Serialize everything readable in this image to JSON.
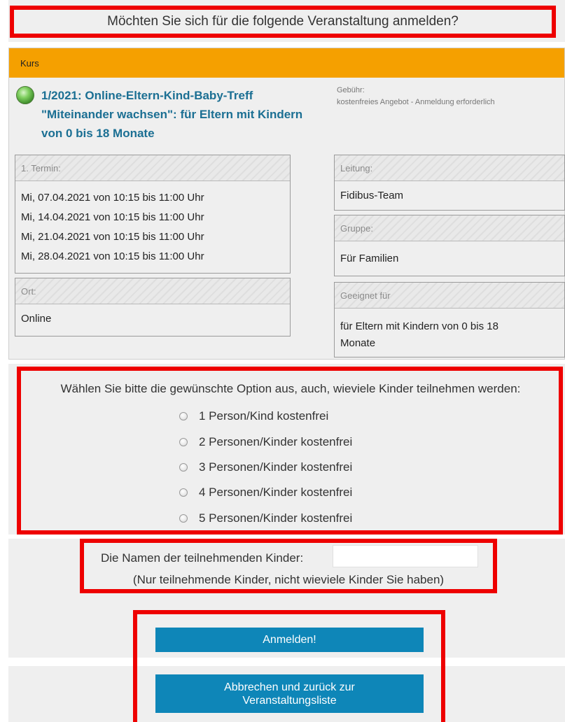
{
  "question": "Möchten Sie sich für die folgende Veranstaltung anmelden?",
  "course": {
    "header": "Kurs",
    "title_lines": [
      "1/2021: Online-Eltern-Kind-Baby-Treff",
      "\"Miteinander wachsen\": für Eltern mit Kindern",
      "von 0 bis 18 Monate"
    ],
    "fee_label": "Gebühr:",
    "fee_value": "kostenfreies Angebot - Anmeldung erforderlich",
    "termin": {
      "label": "1. Termin:",
      "dates": [
        "Mi, 07.04.2021 von 10:15 bis 11:00 Uhr",
        "Mi, 14.04.2021 von 10:15 bis 11:00 Uhr",
        "Mi, 21.04.2021 von 10:15 bis 11:00 Uhr",
        "Mi, 28.04.2021 von 10:15 bis 11:00 Uhr"
      ]
    },
    "ort": {
      "label": "Ort:",
      "value": "Online"
    },
    "leitung": {
      "label": "Leitung:",
      "value": "Fidibus-Team"
    },
    "gruppe": {
      "label": "Gruppe:",
      "value": "Für Familien"
    },
    "geeignet": {
      "label": "Geeignet für",
      "lines": [
        "für Eltern mit Kindern von 0 bis 18",
        "Monate"
      ]
    }
  },
  "options": {
    "prompt": "Wählen Sie bitte die gewünschte Option aus, auch, wieviele Kinder teilnehmen werden:",
    "items": [
      "1 Person/Kind kostenfrei",
      "2 Personen/Kinder kostenfrei",
      "3 Personen/Kinder kostenfrei",
      "4 Personen/Kinder kostenfrei",
      "5 Personen/Kinder kostenfrei"
    ]
  },
  "children": {
    "label": "Die Namen der teilnehmenden Kinder:",
    "value": "",
    "note": "(Nur teilnehmende Kinder, nicht wieviele Kinder Sie haben)"
  },
  "buttons": {
    "register": "Anmelden!",
    "cancel_lines": [
      "Abbrechen und zurück zur",
      "Veranstaltungsliste"
    ]
  },
  "colors": {
    "accent_header": "#f5a000",
    "title_blue": "#1b6f93",
    "button_blue": "#0e86b8",
    "highlight_red": "#ee0000"
  }
}
